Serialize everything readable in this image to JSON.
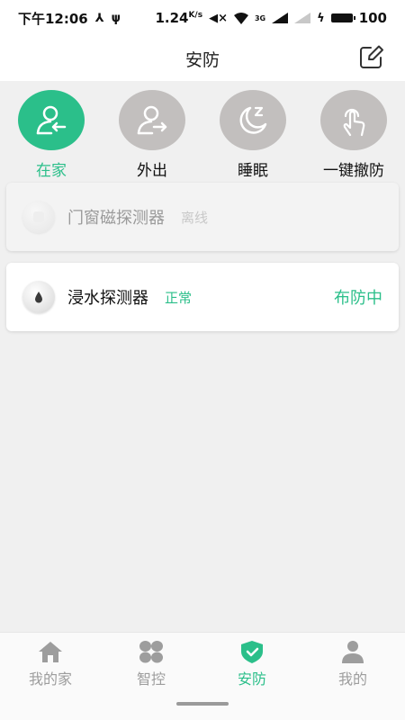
{
  "status_bar": {
    "time": "下午12:06",
    "speed": "1.24",
    "speed_unit": "K/s",
    "signal_type": "3G",
    "battery": "100"
  },
  "header": {
    "title": "安防",
    "edit_icon": "edit-icon"
  },
  "modes": [
    {
      "label": "在家",
      "icon": "home-user-icon",
      "active": true
    },
    {
      "label": "外出",
      "icon": "leave-user-icon",
      "active": false
    },
    {
      "label": "睡眠",
      "icon": "moon-sleep-icon",
      "active": false
    },
    {
      "label": "一键撤防",
      "icon": "tap-hand-icon",
      "active": false
    }
  ],
  "devices": [
    {
      "name": "门窗磁探测器",
      "status": "离线",
      "arm_status": "",
      "online": false
    },
    {
      "name": "浸水探测器",
      "status": "正常",
      "arm_status": "布防中",
      "online": true
    }
  ],
  "tabs": [
    {
      "label": "我的家",
      "icon": "home-icon",
      "active": false
    },
    {
      "label": "智控",
      "icon": "grid-icon",
      "active": false
    },
    {
      "label": "安防",
      "icon": "shield-check-icon",
      "active": true
    },
    {
      "label": "我的",
      "icon": "person-icon",
      "active": false
    }
  ],
  "colors": {
    "accent": "#2bbf8a",
    "inactive_circle": "#c2bfbe",
    "tab_inactive": "#9d9d9d"
  }
}
